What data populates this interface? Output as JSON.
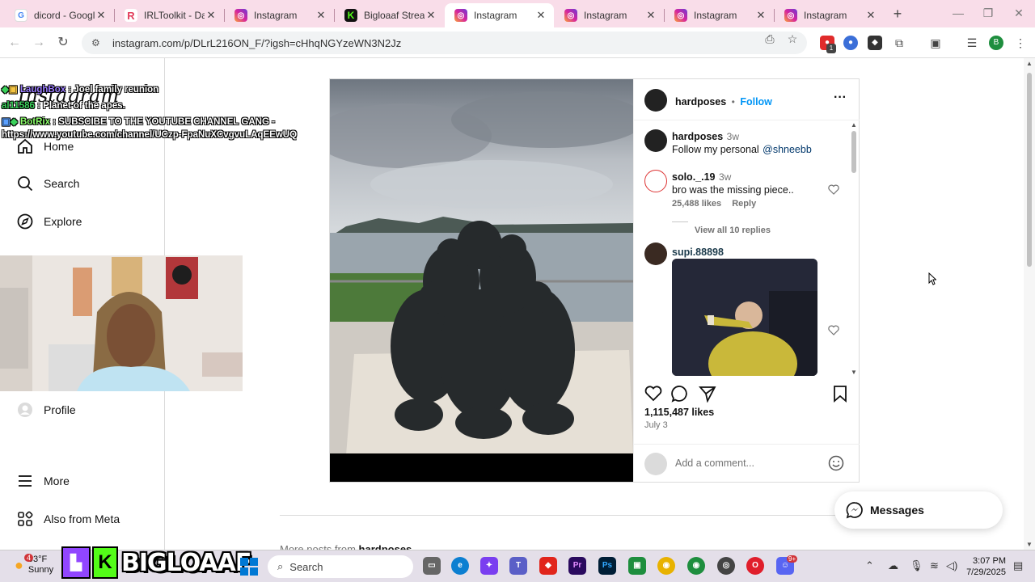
{
  "browser": {
    "tabs": [
      {
        "title": "dicord - Google S",
        "favicon": "google-icon",
        "color": "#4285f4"
      },
      {
        "title": "IRLToolkit - Dashb",
        "favicon": "irltoolkit-icon",
        "color": "#e23b5a"
      },
      {
        "title": "Instagram",
        "favicon": "instagram-icon",
        "color": "#d6249f"
      },
      {
        "title": "Bigloaaf Stream",
        "favicon": "kick-icon",
        "color": "#53fc18"
      },
      {
        "title": "Instagram",
        "favicon": "instagram-icon",
        "color": "#d6249f"
      },
      {
        "title": "Instagram",
        "favicon": "instagram-icon",
        "color": "#d6249f"
      },
      {
        "title": "Instagram",
        "favicon": "instagram-icon",
        "color": "#d6249f"
      },
      {
        "title": "Instagram",
        "favicon": "instagram-icon",
        "color": "#d6249f"
      }
    ],
    "active_tab_index": 4,
    "url": "instagram.com/p/DLrL216ON_F/?igsh=cHhqNGYzeWN3N2Jz",
    "profile_initial": "B",
    "ext_badge": "1"
  },
  "instagram": {
    "logo": "Instagram",
    "nav": [
      {
        "label": "Home",
        "icon": "home-icon"
      },
      {
        "label": "Search",
        "icon": "search-icon"
      },
      {
        "label": "Explore",
        "icon": "explore-icon"
      },
      {
        "label": "Profile",
        "icon": "profile-icon"
      },
      {
        "label": "More",
        "icon": "menu-icon"
      },
      {
        "label": "Also from Meta",
        "icon": "meta-icon"
      }
    ],
    "post": {
      "author": "hardposes",
      "follow_label": "Follow",
      "separator": "•",
      "caption_author": "hardposes",
      "caption_time": "3w",
      "caption_text": "Follow my personal",
      "caption_mention": "@shneebb",
      "comments": [
        {
          "user": "solo._.19",
          "time": "3w",
          "text": "bro was the missing piece..",
          "likes": "25,488 likes",
          "reply_label": "Reply",
          "view_replies": "View all 10 replies"
        },
        {
          "user": "supi.88898"
        }
      ],
      "likes": "1,115,487 likes",
      "date": "July 3",
      "add_comment_placeholder": "Add a comment..."
    },
    "messages_label": "Messages",
    "more_posts_prefix": "More posts from",
    "more_posts_user": "hardposes"
  },
  "stream_overlay": {
    "chat": [
      {
        "user": "LaughBox",
        "msg": ": Joel family reunion"
      },
      {
        "user": "al11586",
        "msg": ": Planet of the apes."
      },
      {
        "user": "BotRix",
        "msg": ": SUBSCIBE TO THE YOUTUBE CHANNEL GANG -"
      },
      {
        "user": "",
        "msg": "https://www.youtube.com/channel/UCzp-FpaNuXCvgvuLAqEEwUQ"
      }
    ],
    "brand": "BIGLOAAF"
  },
  "taskbar": {
    "weather_temp": "93°F",
    "weather_desc": "Sunny",
    "weather_badge": "4",
    "search_label": "Search",
    "time": "3:07 PM",
    "date": "7/29/2025",
    "discord_badge": "9+"
  }
}
